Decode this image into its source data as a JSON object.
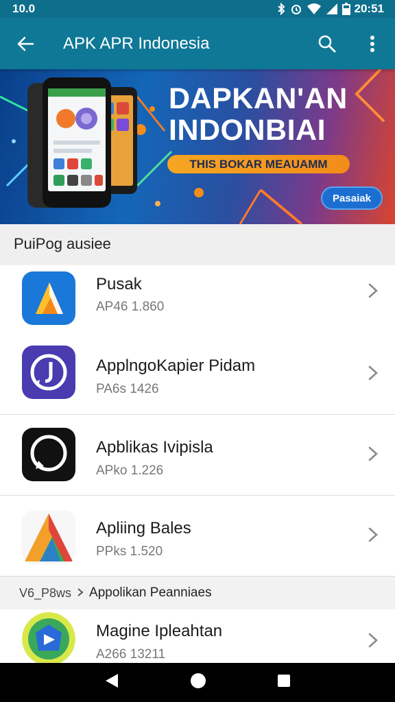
{
  "status_bar": {
    "left_text": "10.0",
    "time": "20:51"
  },
  "app_bar": {
    "title": "APK APR Indonesia"
  },
  "banner": {
    "headline_line1": "DAPKAN'AN",
    "headline_line2": "INDONBIAI",
    "tagline": "THIS BOKAR MEAUAMM",
    "cta_label": "Pasaiak"
  },
  "section": {
    "title": "PuiPog ausiee"
  },
  "apps": [
    {
      "name": "Pusak",
      "version": "AP46 1.860"
    },
    {
      "name": "ApplngoKapier Pidam",
      "version": "PA6s 1426"
    },
    {
      "name": "Apblikas Ivipisla",
      "version": "APko 1.226"
    },
    {
      "name": "Apliing Bales",
      "version": "PPks 1.520"
    }
  ],
  "chip": {
    "prefix": "V6_P8ws",
    "label": "Appolikan Peanniaes"
  },
  "last_app": {
    "name": "Magine Ipleahtan",
    "version": "A266 13211"
  },
  "colors": {
    "app_bar": "#0f7896",
    "status_bar": "#0e6f8d",
    "accent_orange": "#f5a623",
    "nav_bar": "#000000"
  }
}
